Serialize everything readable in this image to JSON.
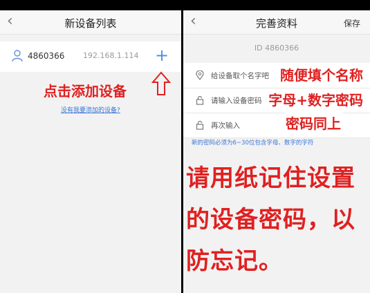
{
  "left": {
    "title": "新设备列表",
    "device": {
      "id": "4860366",
      "ip": "192.168.1.114"
    },
    "annotation": "点击添加设备",
    "missing_link": "没有我要添加的设备?"
  },
  "right": {
    "title": "完善资料",
    "save_label": "保存",
    "id_line": "ID 4860366",
    "fields": [
      {
        "placeholder": "给设备取个名字吧"
      },
      {
        "placeholder": "请输入设备密码"
      },
      {
        "placeholder": "再次输入"
      }
    ],
    "hint": "新的密码必须为6~30位包含字母、数字的字符",
    "annotations": {
      "name": "随便填个名称",
      "password": "字母+数字密码",
      "same": "密码同上"
    },
    "big_note": [
      "请用纸记住设置",
      "的设备密码，以",
      "防忘记。"
    ]
  },
  "colors": {
    "accent": "#4f8fe0",
    "annotation": "#e02020",
    "link": "#3a76d6"
  },
  "icons": {
    "user": "user-icon",
    "location": "location-pin-icon",
    "lock": "lock-icon",
    "back": "back-chevron-icon",
    "plus": "plus-icon"
  }
}
